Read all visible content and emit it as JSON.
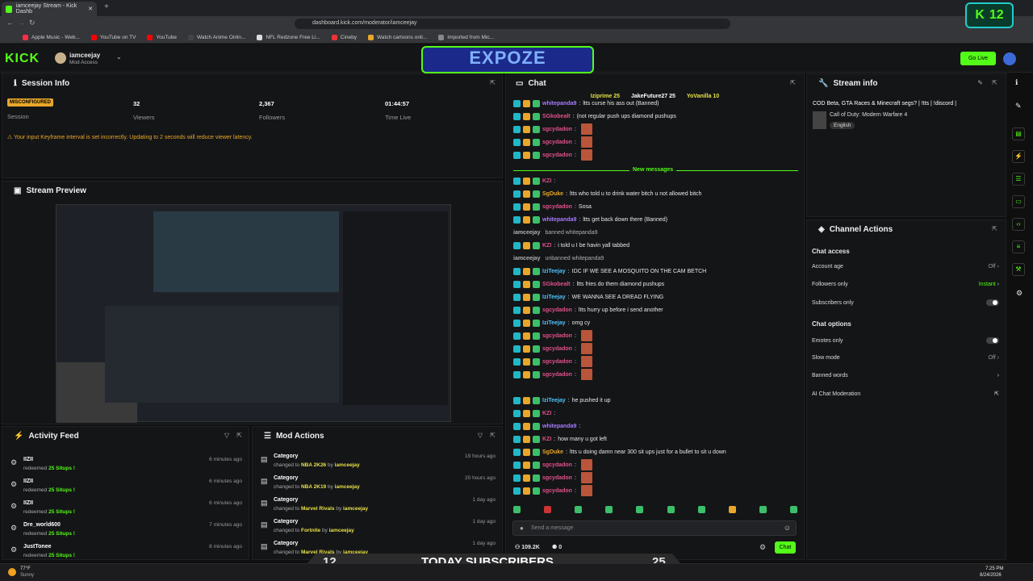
{
  "browser": {
    "tab_title": "iamceejay Stream - Kick Dashb",
    "url": "dashboard.kick.com/moderator/iamceejay",
    "bookmarks": [
      "Apple Music - Web...",
      "YouTube on TV",
      "YouTube",
      "Watch Anime Onlin...",
      "NFL Redzone Free Li...",
      "Cineby",
      "Watch cartoons onli...",
      "Imported from Mic..."
    ]
  },
  "header": {
    "logo": "KICK",
    "user": "iamceejay",
    "role": "Mod Access",
    "go_live": "Go Live"
  },
  "overlay": {
    "expoze": "EXPOZE",
    "badge_count": "12",
    "banner_left": "12",
    "banner_text": "TODAY SUBSCRIBERS",
    "banner_right": "25"
  },
  "session": {
    "title": "Session Info",
    "status": "MISCONFIGURED",
    "status_label": "Session",
    "viewers": "32",
    "viewers_label": "Viewers",
    "followers": "2,367",
    "followers_label": "Followers",
    "time": "01:44:57",
    "time_label": "Time Live",
    "warning": "Your input Keyframe interval is set incorrectly. Updating to 2 seconds will reduce viewer latency."
  },
  "preview": {
    "title": "Stream Preview"
  },
  "activity": {
    "title": "Activity Feed",
    "items": [
      {
        "name": "IIZII",
        "desc": "redeemed",
        "reward": "25 Situps !",
        "time": "6 minutes ago"
      },
      {
        "name": "IIZII",
        "desc": "redeemed",
        "reward": "25 Situps !",
        "time": "6 minutes ago"
      },
      {
        "name": "IIZII",
        "desc": "redeemed",
        "reward": "25 Situps !",
        "time": "6 minutes ago"
      },
      {
        "name": "Dre_world600",
        "desc": "redeemed",
        "reward": "25 Situps !",
        "time": "7 minutes ago"
      },
      {
        "name": "JustTonee",
        "desc": "redeemed",
        "reward": "25 Situps !",
        "time": "8 minutes ago"
      }
    ]
  },
  "mod_actions": {
    "title": "Mod Actions",
    "items": [
      {
        "label": "Category",
        "changed": "changed to",
        "value": "NBA 2K26",
        "by": "by",
        "user": "iamceejay",
        "time": "19 hours ago"
      },
      {
        "label": "Category",
        "changed": "changed to",
        "value": "NBA 2K19",
        "by": "by",
        "user": "iamceejay",
        "time": "20 hours ago"
      },
      {
        "label": "Category",
        "changed": "changed to",
        "value": "Marvel Rivals",
        "by": "by",
        "user": "iamceejay",
        "time": "1 day ago"
      },
      {
        "label": "Category",
        "changed": "changed to",
        "value": "Fortnite",
        "by": "by",
        "user": "iamceejay",
        "time": "1 day ago"
      },
      {
        "label": "Category",
        "changed": "changed to",
        "value": "Marvel Rivals",
        "by": "by",
        "user": "iamceejay",
        "time": "1 day ago"
      }
    ]
  },
  "chat": {
    "title": "Chat",
    "top": [
      "Iziprime 25",
      "JakeFuture27 25",
      "YoVanilla 10"
    ],
    "new_messages": "New messages",
    "placeholder": "Send a message",
    "viewers": "109.2K",
    "count": "0",
    "send": "Chat",
    "messages": [
      {
        "user": "whitepanda9",
        "color": "#a77bff",
        "text": "ltts curse his ass out (Banned)"
      },
      {
        "user": "SGkobealt",
        "color": "#e0508a",
        "text": "(not regular push ups diamond pushups"
      },
      {
        "user": "sgcydadon",
        "color": "#e0508a",
        "text": ""
      },
      {
        "user": "sgcydadon",
        "color": "#e0508a",
        "text": ""
      },
      {
        "user": "sgcydadon",
        "color": "#e0508a",
        "text": ""
      },
      {
        "user": "KZI",
        "color": "#e0508a",
        "text": ""
      },
      {
        "user": "SgDuke",
        "color": "#e8a72a",
        "text": "ltts who told u to drink water bitch u not allowed bitch"
      },
      {
        "user": "sgcydadon",
        "color": "#e0508a",
        "text": "Sosa"
      },
      {
        "user": "whitepanda9",
        "color": "#a77bff",
        "text": "ltts get back down there (Banned)"
      },
      {
        "user": "iamceejay",
        "color": "#b0b0b0",
        "text": "banned whitepanda9"
      },
      {
        "user": "KZI",
        "color": "#e0508a",
        "text": "i told u I be havin yall tabbed"
      },
      {
        "user": "iamceejay",
        "color": "#b0b0b0",
        "text": "unbanned whitepanda9"
      },
      {
        "user": "IziTeejay",
        "color": "#4dc3ff",
        "text": "IDC IF WE SEE A MOSQUITO ON THE CAM BETCH"
      },
      {
        "user": "SGkobealt",
        "color": "#e0508a",
        "text": "ltts fries do them diamond pushups"
      },
      {
        "user": "IziTeejay",
        "color": "#4dc3ff",
        "text": "WE WANNA SEE A DREAD FLYING"
      },
      {
        "user": "sgcydadon",
        "color": "#e0508a",
        "text": "ltts hurry up before i send another"
      },
      {
        "user": "IziTeejay",
        "color": "#4dc3ff",
        "text": "omg cy"
      },
      {
        "user": "sgcydadon",
        "color": "#e0508a",
        "text": ""
      },
      {
        "user": "sgcydadon",
        "color": "#e0508a",
        "text": ""
      },
      {
        "user": "sgcydadon",
        "color": "#e0508a",
        "text": ""
      },
      {
        "user": "sgcydadon",
        "color": "#e0508a",
        "text": ""
      },
      {
        "user": "IziTeejay",
        "color": "#4dc3ff",
        "text": "he pushed it up"
      },
      {
        "user": "KZI",
        "color": "#e0508a",
        "text": ""
      },
      {
        "user": "whitepanda9",
        "color": "#a77bff",
        "text": ""
      },
      {
        "user": "KZI",
        "color": "#e0508a",
        "text": "how many u got left"
      },
      {
        "user": "SgDuke",
        "color": "#e8a72a",
        "text": "ltts u doing damn near 300 sit ups just for a bullet to sit u down"
      },
      {
        "user": "sgcydadon",
        "color": "#e0508a",
        "text": ""
      },
      {
        "user": "sgcydadon",
        "color": "#e0508a",
        "text": ""
      },
      {
        "user": "sgcydadon",
        "color": "#e0508a",
        "text": ""
      }
    ]
  },
  "stream_info": {
    "title": "Stream info",
    "stream_title": "COD Beta, GTA Races & Minecraft segs? | !tts | !discord |",
    "category": "Call of Duty: Modern Warfare 4",
    "language": "English"
  },
  "channel_actions": {
    "title": "Channel Actions",
    "chat_access": "Chat access",
    "chat_options": "Chat options",
    "rows": [
      {
        "label": "Account age",
        "value": "Off"
      },
      {
        "label": "Followers only",
        "value": "Instant"
      },
      {
        "label": "Subscribers only",
        "value": ""
      }
    ],
    "opts": [
      {
        "label": "Emotes only",
        "value": ""
      },
      {
        "label": "Slow mode",
        "value": "Off"
      },
      {
        "label": "Banned words",
        "value": ""
      },
      {
        "label": "AI Chat Moderation",
        "value": ""
      }
    ]
  },
  "taskbar": {
    "weather": "77°F",
    "weather_sub": "Sunny",
    "time": "7:25 PM",
    "date": "8/24/2026"
  }
}
